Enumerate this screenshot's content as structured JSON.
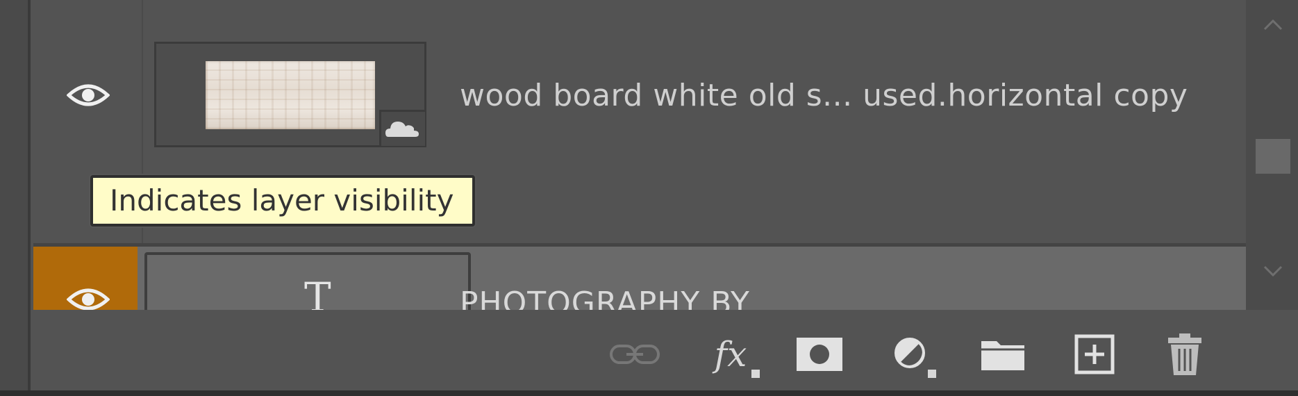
{
  "layers": [
    {
      "name": "wood board white old s... used.horizontal copy",
      "visible": true,
      "icon": "eye-icon",
      "thumbnail": "wood-texture",
      "badge": "cloud-icon"
    },
    {
      "name": "PHOTOGRAPHY BY",
      "visible": true,
      "icon": "eye-icon",
      "thumbnail_glyph": "T",
      "selected": true
    }
  ],
  "tooltip": {
    "text": "Indicates layer visibility"
  },
  "toolbar": {
    "link_icon": "link-icon",
    "fx_label": "fx",
    "mask_icon": "layer-mask-icon",
    "adjustment_icon": "adjustment-layer-icon",
    "group_icon": "folder-icon",
    "new_layer_icon": "new-layer-icon",
    "delete_icon": "trash-icon"
  },
  "colors": {
    "panel_bg": "#535353",
    "selected_row": "#6a6a6a",
    "visibility_highlight": "#b06a0a",
    "tooltip_bg": "#fffcc8"
  }
}
